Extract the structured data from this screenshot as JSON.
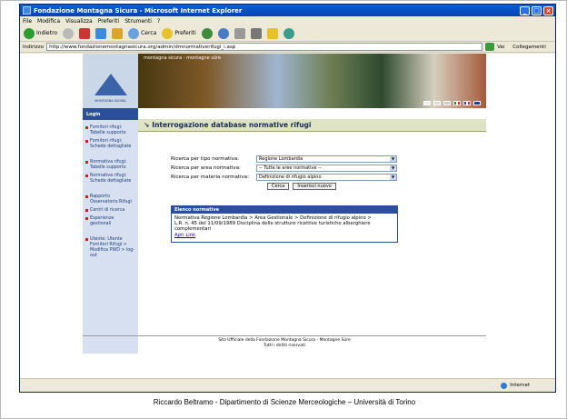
{
  "window": {
    "title": "Fondazione Montagna Sicura - Microsoft Internet Explorer",
    "minimize": "_",
    "maximize": "□",
    "close": "×"
  },
  "menu": [
    "File",
    "Modifica",
    "Visualizza",
    "Preferiti",
    "Strumenti",
    "?"
  ],
  "toolbar": {
    "back": "Indietro",
    "search": "Cerca",
    "favorites": "Preferiti"
  },
  "address": {
    "label": "Indirizzo",
    "url": "http://www.fondazionemontagnasicura.org/admin/dmnormativerifugi_i.asp",
    "go": "Vai",
    "links": "Collegamenti"
  },
  "site": {
    "logo_text": "MONTAGNA SICURA",
    "banner_text": "montagna sicura - montagne sûre",
    "login": "Login",
    "section_title": "Interrogazione database normative rifugi",
    "sidebar": [
      {
        "type": "item",
        "label": "Fornitori rifugi: Tabelle supporto"
      },
      {
        "type": "item",
        "label": "Fornitori rifugi: Schede dettagliate"
      },
      {
        "type": "gap"
      },
      {
        "type": "item",
        "label": "Normativa rifugi: Tabelle supporto"
      },
      {
        "type": "item",
        "label": "Normativa rifugi: Schede dettagliate"
      },
      {
        "type": "gap"
      },
      {
        "type": "item",
        "label": "Rapporto Osservatorio Rifugi"
      },
      {
        "type": "item",
        "label": "Centri di ricerca"
      },
      {
        "type": "item",
        "label": "Esperienze gestionali"
      },
      {
        "type": "gap"
      },
      {
        "type": "item",
        "label": "Utente: Utente Fornitori Rifugi > Modifica PWD > log-out"
      }
    ],
    "form": {
      "tipo_label": "Ricerca per tipo normativa:",
      "tipo_value": "Regione Lombardia",
      "area_label": "Ricerca per area normativa:",
      "area_value": "-- Tutte le aree normative --",
      "materia_label": "Ricerca per materia normativa:",
      "materia_value": "Definizione di rifugio alpino",
      "cerca": "Cerca",
      "inserisci": "Inserisci nuovo"
    },
    "results": {
      "header": "Elenco normative",
      "path": "Normativa Regione Lombardia > Area Gestionale > Definizione di rifugio alpino >",
      "law": "L.R. n. 45 del 11/09/1989 Disciplina delle strutture ricettive turistiche alberghiere complementari",
      "link": "Apri Link"
    },
    "footer_line1": "Sito Ufficiale della Fondazione Montagna Sicura - Montagne Sûre",
    "footer_line2": "Tutti i diritti riservati"
  },
  "status": {
    "zone": "Internet"
  },
  "caption": "Riccardo Beltramo - Dipartimento di Scienze Merceologiche – Università di Torino",
  "colors": {
    "titlebar": "#0a5fd8",
    "nav_blue": "#2b4f9b",
    "sidebar_bg": "#d6e0f0",
    "section_bg": "#dde3c3"
  }
}
